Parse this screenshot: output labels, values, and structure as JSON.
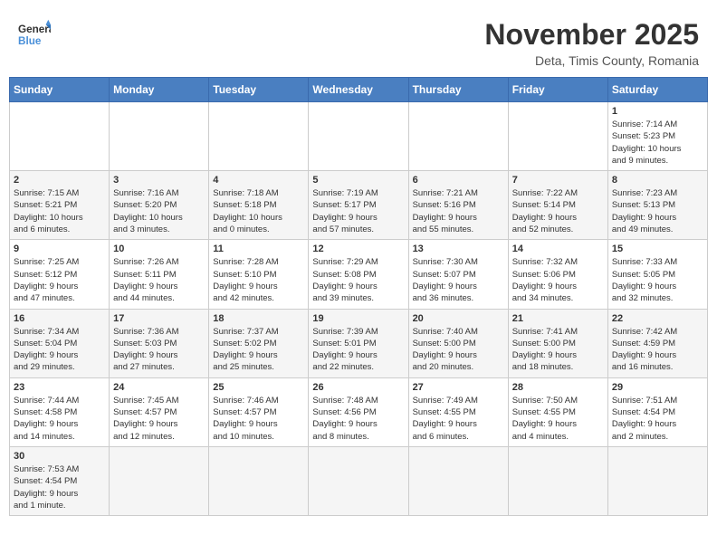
{
  "header": {
    "logo_general": "General",
    "logo_blue": "Blue",
    "month_title": "November 2025",
    "location": "Deta, Timis County, Romania"
  },
  "weekdays": [
    "Sunday",
    "Monday",
    "Tuesday",
    "Wednesday",
    "Thursday",
    "Friday",
    "Saturday"
  ],
  "weeks": [
    [
      {
        "day": "",
        "info": ""
      },
      {
        "day": "",
        "info": ""
      },
      {
        "day": "",
        "info": ""
      },
      {
        "day": "",
        "info": ""
      },
      {
        "day": "",
        "info": ""
      },
      {
        "day": "",
        "info": ""
      },
      {
        "day": "1",
        "info": "Sunrise: 7:14 AM\nSunset: 5:23 PM\nDaylight: 10 hours\nand 9 minutes."
      }
    ],
    [
      {
        "day": "2",
        "info": "Sunrise: 7:15 AM\nSunset: 5:21 PM\nDaylight: 10 hours\nand 6 minutes."
      },
      {
        "day": "3",
        "info": "Sunrise: 7:16 AM\nSunset: 5:20 PM\nDaylight: 10 hours\nand 3 minutes."
      },
      {
        "day": "4",
        "info": "Sunrise: 7:18 AM\nSunset: 5:18 PM\nDaylight: 10 hours\nand 0 minutes."
      },
      {
        "day": "5",
        "info": "Sunrise: 7:19 AM\nSunset: 5:17 PM\nDaylight: 9 hours\nand 57 minutes."
      },
      {
        "day": "6",
        "info": "Sunrise: 7:21 AM\nSunset: 5:16 PM\nDaylight: 9 hours\nand 55 minutes."
      },
      {
        "day": "7",
        "info": "Sunrise: 7:22 AM\nSunset: 5:14 PM\nDaylight: 9 hours\nand 52 minutes."
      },
      {
        "day": "8",
        "info": "Sunrise: 7:23 AM\nSunset: 5:13 PM\nDaylight: 9 hours\nand 49 minutes."
      }
    ],
    [
      {
        "day": "9",
        "info": "Sunrise: 7:25 AM\nSunset: 5:12 PM\nDaylight: 9 hours\nand 47 minutes."
      },
      {
        "day": "10",
        "info": "Sunrise: 7:26 AM\nSunset: 5:11 PM\nDaylight: 9 hours\nand 44 minutes."
      },
      {
        "day": "11",
        "info": "Sunrise: 7:28 AM\nSunset: 5:10 PM\nDaylight: 9 hours\nand 42 minutes."
      },
      {
        "day": "12",
        "info": "Sunrise: 7:29 AM\nSunset: 5:08 PM\nDaylight: 9 hours\nand 39 minutes."
      },
      {
        "day": "13",
        "info": "Sunrise: 7:30 AM\nSunset: 5:07 PM\nDaylight: 9 hours\nand 36 minutes."
      },
      {
        "day": "14",
        "info": "Sunrise: 7:32 AM\nSunset: 5:06 PM\nDaylight: 9 hours\nand 34 minutes."
      },
      {
        "day": "15",
        "info": "Sunrise: 7:33 AM\nSunset: 5:05 PM\nDaylight: 9 hours\nand 32 minutes."
      }
    ],
    [
      {
        "day": "16",
        "info": "Sunrise: 7:34 AM\nSunset: 5:04 PM\nDaylight: 9 hours\nand 29 minutes."
      },
      {
        "day": "17",
        "info": "Sunrise: 7:36 AM\nSunset: 5:03 PM\nDaylight: 9 hours\nand 27 minutes."
      },
      {
        "day": "18",
        "info": "Sunrise: 7:37 AM\nSunset: 5:02 PM\nDaylight: 9 hours\nand 25 minutes."
      },
      {
        "day": "19",
        "info": "Sunrise: 7:39 AM\nSunset: 5:01 PM\nDaylight: 9 hours\nand 22 minutes."
      },
      {
        "day": "20",
        "info": "Sunrise: 7:40 AM\nSunset: 5:00 PM\nDaylight: 9 hours\nand 20 minutes."
      },
      {
        "day": "21",
        "info": "Sunrise: 7:41 AM\nSunset: 5:00 PM\nDaylight: 9 hours\nand 18 minutes."
      },
      {
        "day": "22",
        "info": "Sunrise: 7:42 AM\nSunset: 4:59 PM\nDaylight: 9 hours\nand 16 minutes."
      }
    ],
    [
      {
        "day": "23",
        "info": "Sunrise: 7:44 AM\nSunset: 4:58 PM\nDaylight: 9 hours\nand 14 minutes."
      },
      {
        "day": "24",
        "info": "Sunrise: 7:45 AM\nSunset: 4:57 PM\nDaylight: 9 hours\nand 12 minutes."
      },
      {
        "day": "25",
        "info": "Sunrise: 7:46 AM\nSunset: 4:57 PM\nDaylight: 9 hours\nand 10 minutes."
      },
      {
        "day": "26",
        "info": "Sunrise: 7:48 AM\nSunset: 4:56 PM\nDaylight: 9 hours\nand 8 minutes."
      },
      {
        "day": "27",
        "info": "Sunrise: 7:49 AM\nSunset: 4:55 PM\nDaylight: 9 hours\nand 6 minutes."
      },
      {
        "day": "28",
        "info": "Sunrise: 7:50 AM\nSunset: 4:55 PM\nDaylight: 9 hours\nand 4 minutes."
      },
      {
        "day": "29",
        "info": "Sunrise: 7:51 AM\nSunset: 4:54 PM\nDaylight: 9 hours\nand 2 minutes."
      }
    ],
    [
      {
        "day": "30",
        "info": "Sunrise: 7:53 AM\nSunset: 4:54 PM\nDaylight: 9 hours\nand 1 minute."
      },
      {
        "day": "",
        "info": ""
      },
      {
        "day": "",
        "info": ""
      },
      {
        "day": "",
        "info": ""
      },
      {
        "day": "",
        "info": ""
      },
      {
        "day": "",
        "info": ""
      },
      {
        "day": "",
        "info": ""
      }
    ]
  ]
}
